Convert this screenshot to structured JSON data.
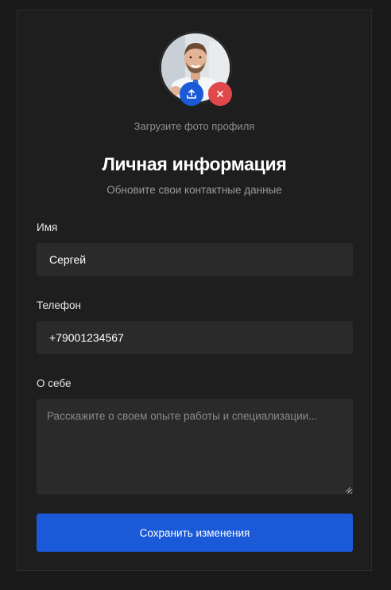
{
  "profile": {
    "upload_hint": "Загрузите фото профиля",
    "title": "Личная информация",
    "subtitle": "Обновите свои контактные данные"
  },
  "form": {
    "name": {
      "label": "Имя",
      "value": "Сергей"
    },
    "phone": {
      "label": "Телефон",
      "value": "+79001234567"
    },
    "about": {
      "label": "О себе",
      "value": "",
      "placeholder": "Расскажите о своем опыте работы и специализации..."
    },
    "save_label": "Сохранить изменения"
  },
  "icons": {
    "upload": "upload-icon",
    "remove": "close-icon"
  },
  "colors": {
    "accent": "#1a5ad8",
    "danger": "#e0484b",
    "background": "#1a1a1a",
    "card": "#1e1e1e",
    "input": "#2a2a2a"
  }
}
